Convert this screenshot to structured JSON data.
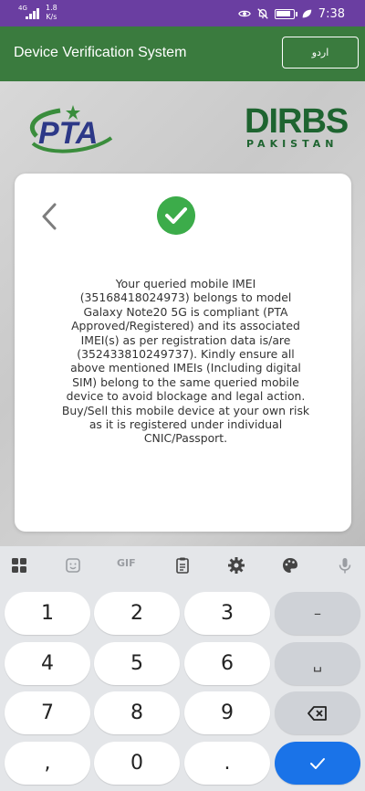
{
  "status_bar": {
    "network": "4G",
    "speed_value": "1.8",
    "speed_unit": "K/s",
    "time": "7:38"
  },
  "app_bar": {
    "title": "Device Verification System",
    "language_button": "اردو"
  },
  "logos": {
    "pta": "PTA",
    "dirbs": "DIRBS",
    "dirbs_sub": "PAKISTAN"
  },
  "card": {
    "message": "Your queried mobile IMEI (35168418024973) belongs to model Galaxy Note20 5G is compliant (PTA Approved/Registered) and its associated IMEI(s) as per registration data is/are (352433810249737). Kindly ensure all above mentioned IMEIs (Including digital SIM) belong to the same queried mobile device to avoid blockage and legal action. Buy/Sell this mobile device at your own risk as it is registered under individual CNIC/Passport."
  },
  "keyboard": {
    "toolbar": {
      "gif": "GIF",
      "icons": [
        "apps-icon",
        "sticker-icon",
        "gif-icon",
        "clipboard-icon",
        "settings-icon",
        "palette-icon",
        "microphone-icon"
      ]
    },
    "keys": {
      "k1": "1",
      "k2": "2",
      "k3": "3",
      "minus": "–",
      "k4": "4",
      "k5": "5",
      "k6": "6",
      "space": "␣",
      "k7": "7",
      "k8": "8",
      "k9": "9",
      "comma": ",",
      "k0": "0",
      "period": "."
    }
  },
  "colors": {
    "status_bar": "#6a3ea1",
    "app_bar": "#3a7b3e",
    "success": "#3cac4a",
    "pta_blue": "#2c3887",
    "dirbs_green": "#1e6430",
    "enter_key": "#1a73e8"
  }
}
